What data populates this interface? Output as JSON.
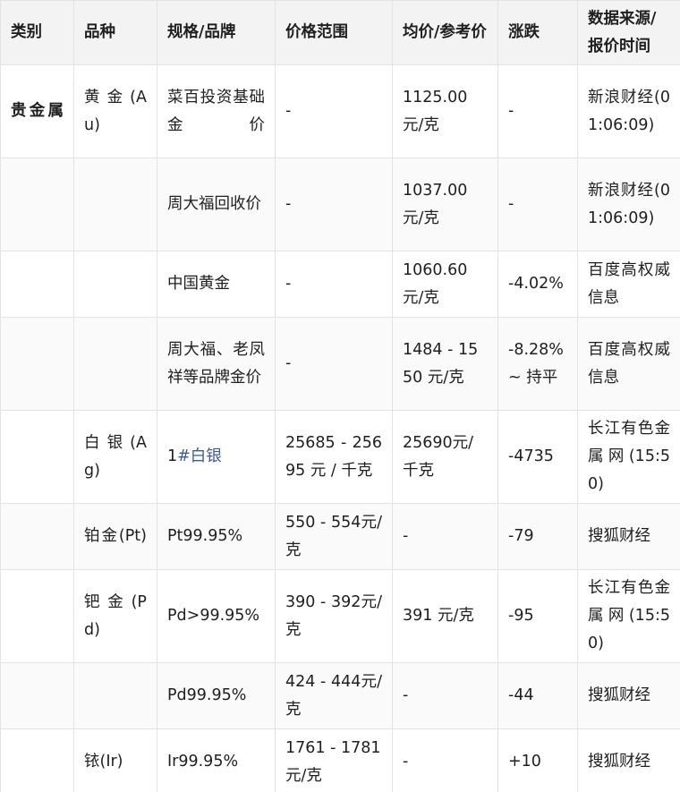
{
  "table": {
    "headers": [
      "类别",
      "品种",
      "规格/品牌",
      "价格范围",
      "均价/参考价",
      "涨跌",
      "数据来源/报价时间"
    ],
    "rows": [
      {
        "category": "贵金属",
        "variety": "黄金(Au)",
        "spec": "菜百投资基础金价",
        "range": "-",
        "avg": "1125.00元/克",
        "change": "-",
        "source": "新浪财经(01:06:09)"
      },
      {
        "category": "",
        "variety": "",
        "spec": "周大福回收价",
        "range": "-",
        "avg": "1037.00元/克",
        "change": "-",
        "source": "新浪财经(01:06:09)"
      },
      {
        "category": "",
        "variety": "",
        "spec": "中国黄金",
        "range": "-",
        "avg": "1060.60元/克",
        "change": "-4.02%",
        "source": "百度高权威信息"
      },
      {
        "category": "",
        "variety": "",
        "spec": "周大福、老凤祥等品牌金价",
        "range": "-",
        "avg": "1484 - 1550 元/克",
        "change": "-8.28% ~ 持平",
        "source": "百度高权威信息"
      },
      {
        "category": "",
        "variety": "白银(Ag)",
        "spec_prefix": "1",
        "spec_link": "#白银",
        "range": "25685 - 25695 元 / 千克",
        "avg": "25690元/千克",
        "change": "-4735",
        "source": "长江有色金属网(15:50)"
      },
      {
        "category": "",
        "variety": "铂金(Pt)",
        "spec": "Pt99.95%",
        "range": "550 - 554元/克",
        "avg": "-",
        "change": "-79",
        "source": "搜狐财经"
      },
      {
        "category": "",
        "variety": "钯金(Pd)",
        "spec": "Pd>99.95%",
        "range": "390 - 392元/克",
        "avg": "391 元/克",
        "change": "-95",
        "source": "长江有色金属网(15:50)"
      },
      {
        "category": "",
        "variety": "",
        "spec": "Pd99.95%",
        "range": "424 - 444元/克",
        "avg": "-",
        "change": "-44",
        "source": "搜狐财经"
      },
      {
        "category": "",
        "variety": "铱(Ir)",
        "spec": "Ir99.95%",
        "range": "1761 - 1781 元/克",
        "avg": "-",
        "change": "+10",
        "source": "搜狐财经"
      }
    ]
  }
}
